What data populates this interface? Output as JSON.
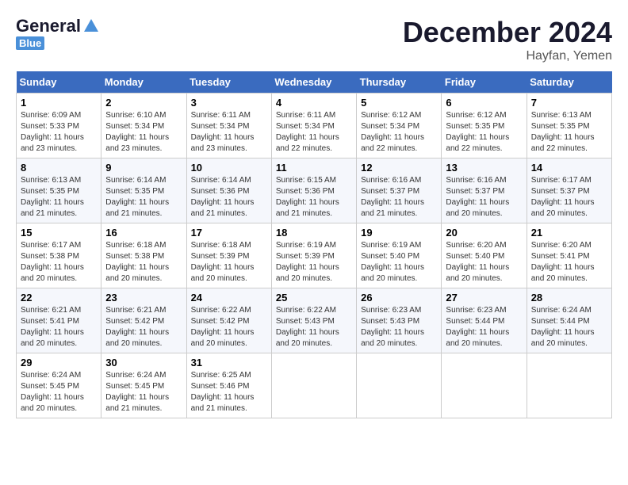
{
  "header": {
    "logo_general": "General",
    "logo_blue": "Blue",
    "month_title": "December 2024",
    "location": "Hayfan, Yemen"
  },
  "weekdays": [
    "Sunday",
    "Monday",
    "Tuesday",
    "Wednesday",
    "Thursday",
    "Friday",
    "Saturday"
  ],
  "weeks": [
    [
      {
        "day": "1",
        "sunrise": "6:09 AM",
        "sunset": "5:33 PM",
        "daylight": "11 hours and 23 minutes."
      },
      {
        "day": "2",
        "sunrise": "6:10 AM",
        "sunset": "5:34 PM",
        "daylight": "11 hours and 23 minutes."
      },
      {
        "day": "3",
        "sunrise": "6:11 AM",
        "sunset": "5:34 PM",
        "daylight": "11 hours and 23 minutes."
      },
      {
        "day": "4",
        "sunrise": "6:11 AM",
        "sunset": "5:34 PM",
        "daylight": "11 hours and 22 minutes."
      },
      {
        "day": "5",
        "sunrise": "6:12 AM",
        "sunset": "5:34 PM",
        "daylight": "11 hours and 22 minutes."
      },
      {
        "day": "6",
        "sunrise": "6:12 AM",
        "sunset": "5:35 PM",
        "daylight": "11 hours and 22 minutes."
      },
      {
        "day": "7",
        "sunrise": "6:13 AM",
        "sunset": "5:35 PM",
        "daylight": "11 hours and 22 minutes."
      }
    ],
    [
      {
        "day": "8",
        "sunrise": "6:13 AM",
        "sunset": "5:35 PM",
        "daylight": "11 hours and 21 minutes."
      },
      {
        "day": "9",
        "sunrise": "6:14 AM",
        "sunset": "5:35 PM",
        "daylight": "11 hours and 21 minutes."
      },
      {
        "day": "10",
        "sunrise": "6:14 AM",
        "sunset": "5:36 PM",
        "daylight": "11 hours and 21 minutes."
      },
      {
        "day": "11",
        "sunrise": "6:15 AM",
        "sunset": "5:36 PM",
        "daylight": "11 hours and 21 minutes."
      },
      {
        "day": "12",
        "sunrise": "6:16 AM",
        "sunset": "5:37 PM",
        "daylight": "11 hours and 21 minutes."
      },
      {
        "day": "13",
        "sunrise": "6:16 AM",
        "sunset": "5:37 PM",
        "daylight": "11 hours and 20 minutes."
      },
      {
        "day": "14",
        "sunrise": "6:17 AM",
        "sunset": "5:37 PM",
        "daylight": "11 hours and 20 minutes."
      }
    ],
    [
      {
        "day": "15",
        "sunrise": "6:17 AM",
        "sunset": "5:38 PM",
        "daylight": "11 hours and 20 minutes."
      },
      {
        "day": "16",
        "sunrise": "6:18 AM",
        "sunset": "5:38 PM",
        "daylight": "11 hours and 20 minutes."
      },
      {
        "day": "17",
        "sunrise": "6:18 AM",
        "sunset": "5:39 PM",
        "daylight": "11 hours and 20 minutes."
      },
      {
        "day": "18",
        "sunrise": "6:19 AM",
        "sunset": "5:39 PM",
        "daylight": "11 hours and 20 minutes."
      },
      {
        "day": "19",
        "sunrise": "6:19 AM",
        "sunset": "5:40 PM",
        "daylight": "11 hours and 20 minutes."
      },
      {
        "day": "20",
        "sunrise": "6:20 AM",
        "sunset": "5:40 PM",
        "daylight": "11 hours and 20 minutes."
      },
      {
        "day": "21",
        "sunrise": "6:20 AM",
        "sunset": "5:41 PM",
        "daylight": "11 hours and 20 minutes."
      }
    ],
    [
      {
        "day": "22",
        "sunrise": "6:21 AM",
        "sunset": "5:41 PM",
        "daylight": "11 hours and 20 minutes."
      },
      {
        "day": "23",
        "sunrise": "6:21 AM",
        "sunset": "5:42 PM",
        "daylight": "11 hours and 20 minutes."
      },
      {
        "day": "24",
        "sunrise": "6:22 AM",
        "sunset": "5:42 PM",
        "daylight": "11 hours and 20 minutes."
      },
      {
        "day": "25",
        "sunrise": "6:22 AM",
        "sunset": "5:43 PM",
        "daylight": "11 hours and 20 minutes."
      },
      {
        "day": "26",
        "sunrise": "6:23 AM",
        "sunset": "5:43 PM",
        "daylight": "11 hours and 20 minutes."
      },
      {
        "day": "27",
        "sunrise": "6:23 AM",
        "sunset": "5:44 PM",
        "daylight": "11 hours and 20 minutes."
      },
      {
        "day": "28",
        "sunrise": "6:24 AM",
        "sunset": "5:44 PM",
        "daylight": "11 hours and 20 minutes."
      }
    ],
    [
      {
        "day": "29",
        "sunrise": "6:24 AM",
        "sunset": "5:45 PM",
        "daylight": "11 hours and 20 minutes."
      },
      {
        "day": "30",
        "sunrise": "6:24 AM",
        "sunset": "5:45 PM",
        "daylight": "11 hours and 21 minutes."
      },
      {
        "day": "31",
        "sunrise": "6:25 AM",
        "sunset": "5:46 PM",
        "daylight": "11 hours and 21 minutes."
      },
      null,
      null,
      null,
      null
    ]
  ]
}
